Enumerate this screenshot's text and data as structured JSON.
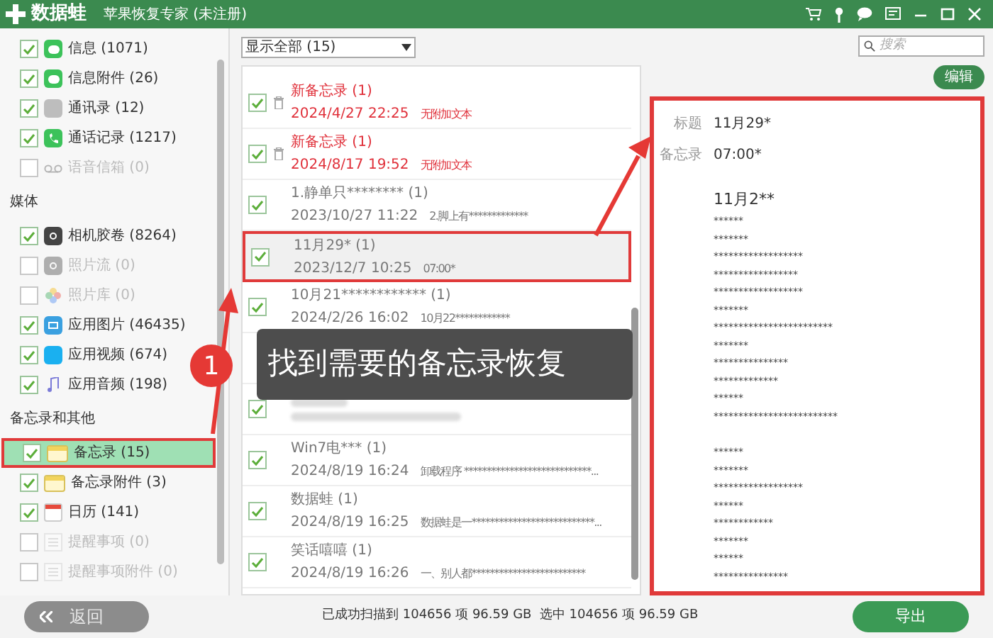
{
  "window": {
    "logo": "数据蛙",
    "title": "苹果恢复专家 (未注册)"
  },
  "sidebar": {
    "sections": [
      {
        "items": [
          {
            "label": "信息 (1071)",
            "checked": true,
            "disabled": false,
            "selected": false,
            "kind": "message"
          },
          {
            "label": "信息附件 (26)",
            "checked": true,
            "disabled": false,
            "selected": false,
            "kind": "message"
          },
          {
            "label": "通讯录 (12)",
            "checked": true,
            "disabled": false,
            "selected": false,
            "kind": "contacts"
          },
          {
            "label": "通话记录 (1217)",
            "checked": true,
            "disabled": false,
            "selected": false,
            "kind": "phone"
          },
          {
            "label": "语音信箱 (0)",
            "checked": false,
            "disabled": true,
            "selected": false,
            "kind": "voicemail"
          }
        ]
      },
      {
        "title": "媒体",
        "items": [
          {
            "label": "相机胶卷 (8264)",
            "checked": true,
            "disabled": false,
            "selected": false,
            "kind": "camera"
          },
          {
            "label": "照片流 (0)",
            "checked": false,
            "disabled": true,
            "selected": false,
            "kind": "camera"
          },
          {
            "label": "照片库 (0)",
            "checked": false,
            "disabled": true,
            "selected": false,
            "kind": "flower"
          },
          {
            "label": "应用图片 (46435)",
            "checked": true,
            "disabled": false,
            "selected": false,
            "kind": "image"
          },
          {
            "label": "应用视频 (674)",
            "checked": true,
            "disabled": false,
            "selected": false,
            "kind": "video"
          },
          {
            "label": "应用音频 (198)",
            "checked": true,
            "disabled": false,
            "selected": false,
            "kind": "music"
          }
        ]
      },
      {
        "title": "备忘录和其他",
        "items": [
          {
            "label": "备忘录 (15)",
            "checked": true,
            "disabled": false,
            "selected": true,
            "kind": "note"
          },
          {
            "label": "备忘录附件 (3)",
            "checked": true,
            "disabled": false,
            "selected": false,
            "kind": "note"
          },
          {
            "label": "日历 (141)",
            "checked": true,
            "disabled": false,
            "selected": false,
            "kind": "calendar"
          },
          {
            "label": "提醒事项 (0)",
            "checked": false,
            "disabled": true,
            "selected": false,
            "kind": "list"
          },
          {
            "label": "提醒事项附件 (0)",
            "checked": false,
            "disabled": true,
            "selected": false,
            "kind": "list"
          }
        ]
      }
    ]
  },
  "filter": {
    "value": "显示全部 (15)"
  },
  "search": {
    "placeholder": "搜索"
  },
  "list": {
    "rows": [
      {
        "kind": "deleted",
        "checked": true,
        "selected": false,
        "title": "新备忘录 (1)",
        "date": "2024/4/27 22:25",
        "preview": "无附加文本"
      },
      {
        "kind": "deleted",
        "checked": true,
        "selected": false,
        "title": "新备忘录 (1)",
        "date": "2024/8/17 19:52",
        "preview": "无附加文本"
      },
      {
        "kind": "normal",
        "checked": true,
        "selected": false,
        "title": "1.静单只******** (1)",
        "date": "2023/10/27 11:22",
        "preview": "2.脚上有*************"
      },
      {
        "kind": "normal",
        "checked": true,
        "selected": true,
        "title": "11月29* (1)",
        "date": "2023/12/7 10:25",
        "preview": "07:00*"
      },
      {
        "kind": "normal",
        "checked": true,
        "selected": false,
        "title": "10月21************ (1)",
        "date": "2024/2/26 16:02",
        "preview": "10月22************"
      },
      {
        "kind": "covered"
      },
      {
        "kind": "blurred",
        "checked": true,
        "selected": false
      },
      {
        "kind": "normal",
        "checked": true,
        "selected": false,
        "title": "Win7电*** (1)",
        "date": "2024/8/19 16:24",
        "preview": "卸载程序 ****************************..."
      },
      {
        "kind": "normal",
        "checked": true,
        "selected": false,
        "title": "数据蛙 (1)",
        "date": "2024/8/19 16:25",
        "preview": "数据蛙是一***************************..."
      },
      {
        "kind": "normal",
        "checked": true,
        "selected": false,
        "title": "笑话嘻嘻 (1)",
        "date": "2024/8/19 16:26",
        "preview": "一、别人都*************************"
      }
    ]
  },
  "detail": {
    "edit_button": "编辑",
    "fields": [
      {
        "label": "标题",
        "value": "11月29*"
      },
      {
        "label": "备忘录",
        "value": "07:00*"
      }
    ],
    "heading": "11月2**",
    "paragraphs": [
      "******\n*******\n******************\n*****************\n******************\n*******\n************************\n*******\n***************\n*************\n******\n*************************",
      "******\n*******\n******************\n******\n************\n*******\n******\n***************"
    ]
  },
  "status_bar": {
    "text": "已成功扫描到 104656 项 96.59 GB  选中 104656 项 96.59 GB"
  },
  "buttons": {
    "back": "返回",
    "export": "导出"
  },
  "annotation": {
    "badge": "1",
    "callout": "找到需要的备忘录恢复"
  }
}
